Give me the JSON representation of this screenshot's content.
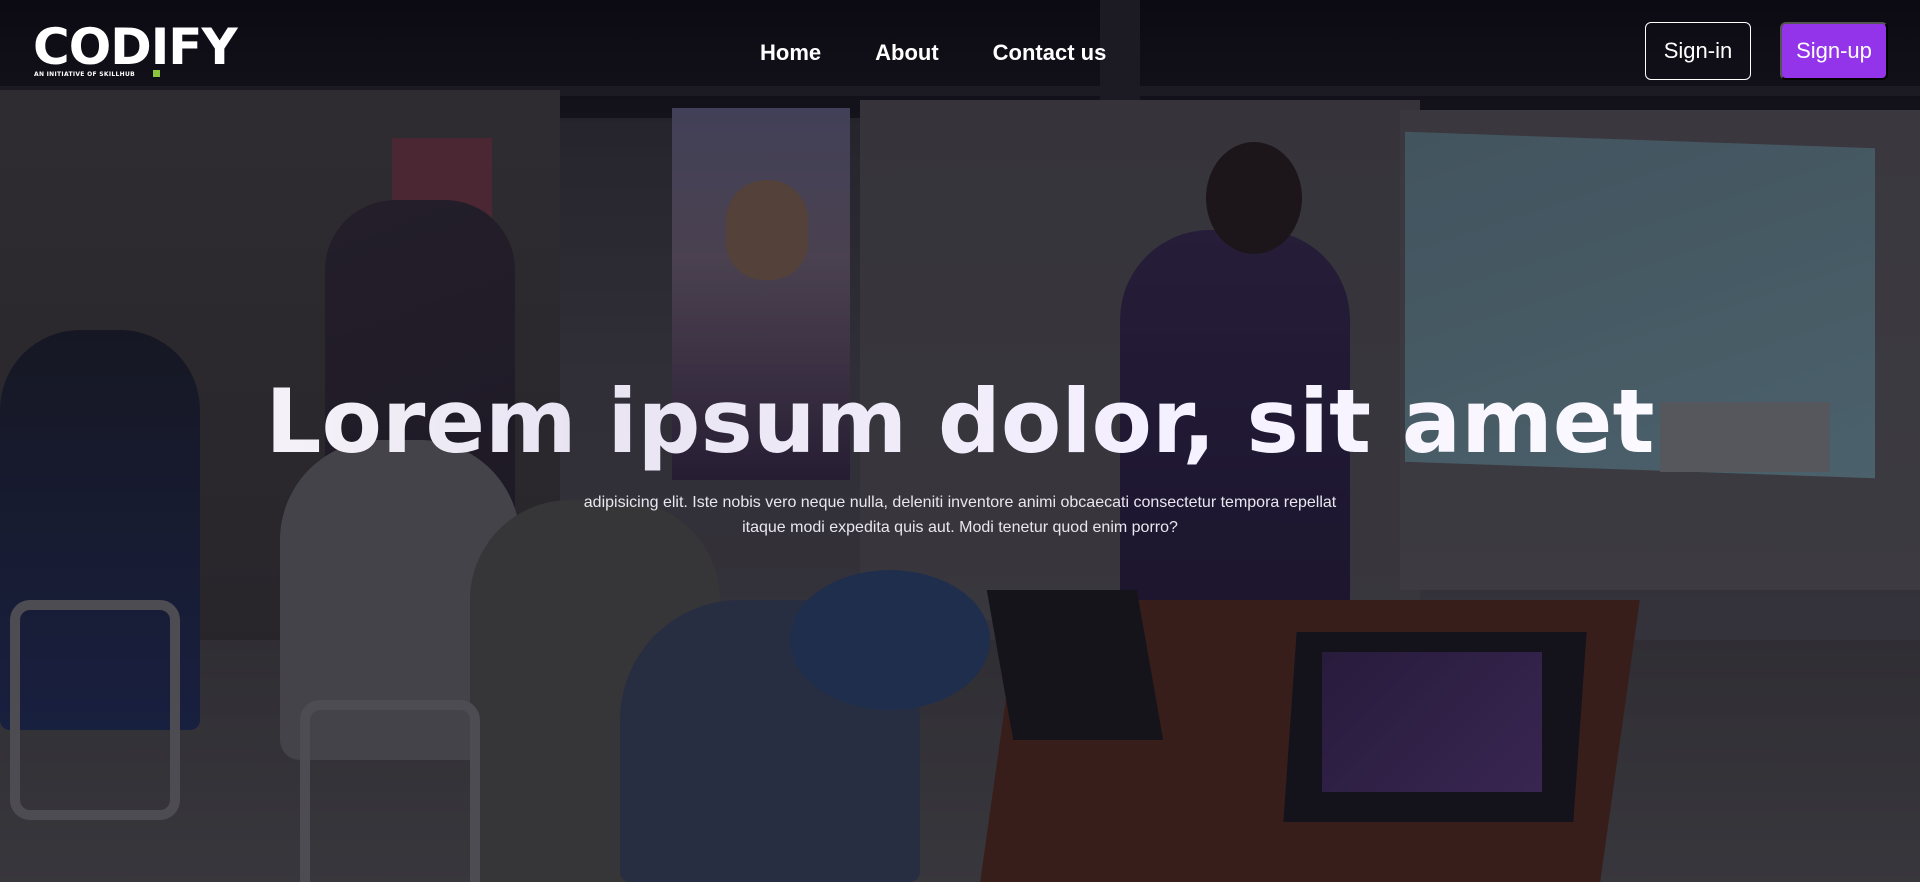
{
  "brand": {
    "name": "CODIFY",
    "tagline": "AN INITIATIVE OF SKILLHUB",
    "accent_color": "#8cc63f"
  },
  "nav": {
    "links": [
      {
        "label": "Home"
      },
      {
        "label": "About"
      },
      {
        "label": "Contact us"
      }
    ],
    "signin_label": "Sign-in",
    "signup_label": "Sign-up",
    "signup_color": "#9333ea"
  },
  "hero": {
    "title": "Lorem ipsum dolor, sit amet",
    "subtitle_line1": "adipisicing elit. Iste nobis vero neque nulla, deleniti inventore animi obcaecati consectetur tempora repellat",
    "subtitle_line2": "itaque modi expedita quis aut. Modi tenetur quod enim porro?",
    "background_image": "classroom-photo"
  }
}
